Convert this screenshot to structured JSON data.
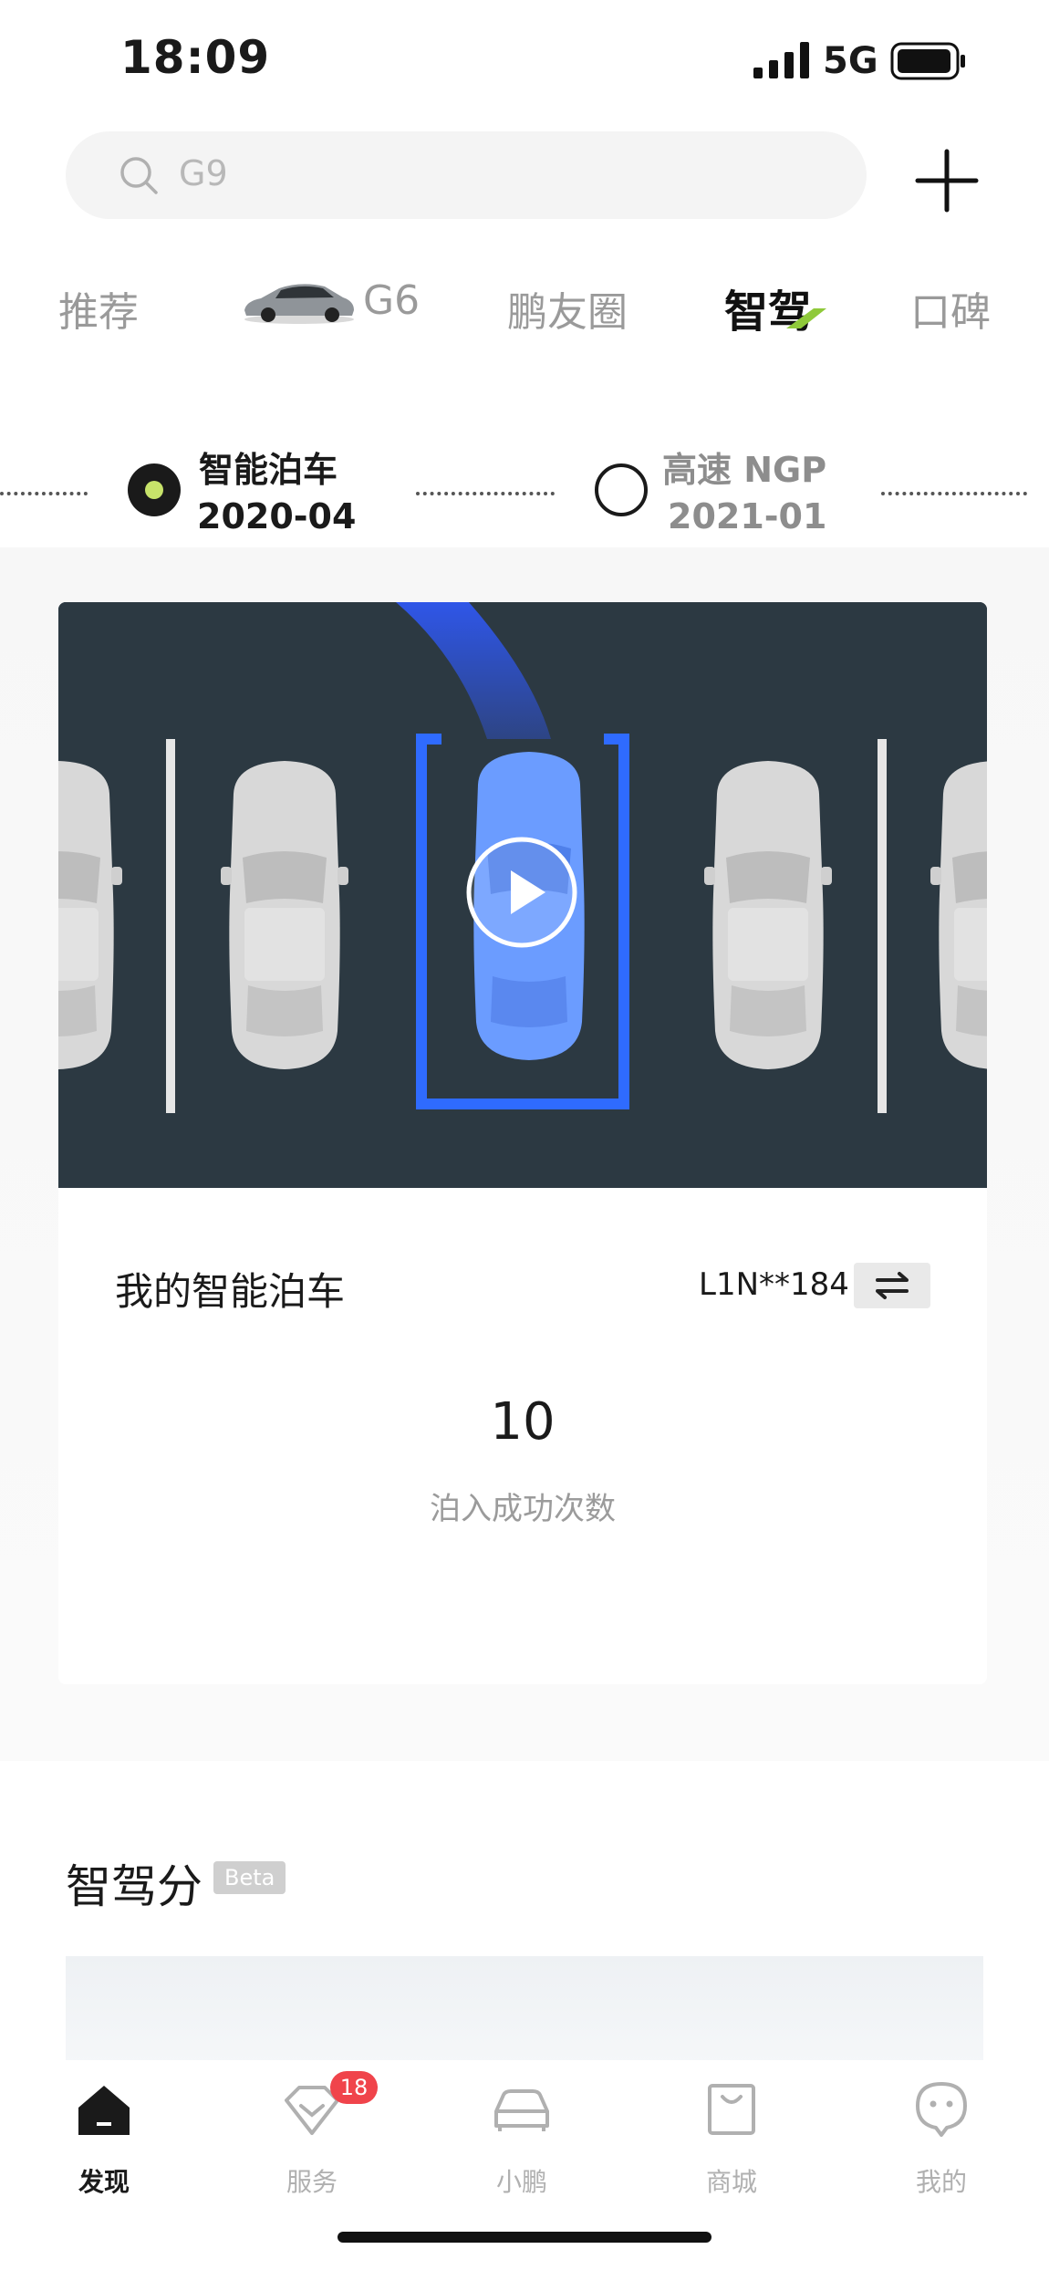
{
  "status_bar": {
    "time": "18:09",
    "network": "5G"
  },
  "search": {
    "placeholder": "G9"
  },
  "tabs": [
    {
      "label": "推荐"
    },
    {
      "label": "G6"
    },
    {
      "label": "鹏友圈"
    },
    {
      "label": "智驾",
      "active": true
    },
    {
      "label": "口碑"
    }
  ],
  "timeline": [
    {
      "title": "智能泊车",
      "date": "2020-04",
      "active": true
    },
    {
      "title": "高速 NGP",
      "date": "2021-01",
      "active": false
    }
  ],
  "parking_card": {
    "title": "我的智能泊车",
    "vin": "L1N**184",
    "stat_value": "10",
    "stat_label": "泊入成功次数"
  },
  "score_section": {
    "title": "智驾分",
    "badge": "Beta"
  },
  "bottom_nav": [
    {
      "label": "发现",
      "icon": "home-icon",
      "active": true
    },
    {
      "label": "服务",
      "icon": "heart-chevron-icon",
      "badge": "18"
    },
    {
      "label": "小鹏",
      "icon": "car-icon"
    },
    {
      "label": "商城",
      "icon": "shopping-bag-icon"
    },
    {
      "label": "我的",
      "icon": "face-icon"
    }
  ],
  "colors": {
    "accent_green": "#c7e36a",
    "parking_blue": "#2f6bff",
    "badge_red": "#f0444b"
  }
}
